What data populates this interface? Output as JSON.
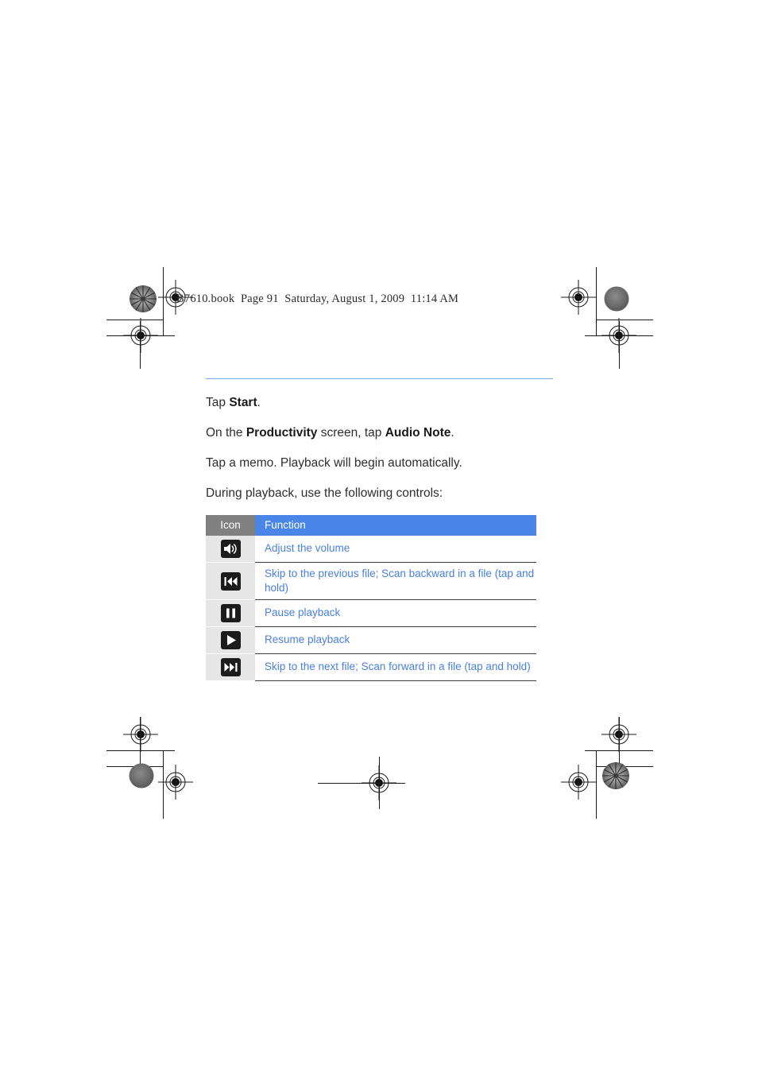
{
  "page": {
    "file_line": "B7610.book  Page 91  Saturday, August 1, 2009  11:14 AM",
    "rule_color": "#7ba7f0",
    "background": "#ffffff"
  },
  "body": {
    "paragraphs": [
      {
        "parts": [
          {
            "text": "Tap ",
            "bold": false
          },
          {
            "text": "Start",
            "bold": true
          },
          {
            "text": ".",
            "bold": false
          }
        ]
      },
      {
        "parts": [
          {
            "text": "On the ",
            "bold": false
          },
          {
            "text": "Productivity",
            "bold": true
          },
          {
            "text": " screen, tap ",
            "bold": false
          },
          {
            "text": "Audio Note",
            "bold": true
          },
          {
            "text": ".",
            "bold": false
          }
        ]
      },
      {
        "parts": [
          {
            "text": "Tap a memo. Playback will begin automatically.",
            "bold": false
          }
        ]
      },
      {
        "parts": [
          {
            "text": "During playback, use the following controls:",
            "bold": false
          }
        ]
      }
    ]
  },
  "table": {
    "header_icon_label": "Icon",
    "header_function_label": "Function",
    "header_icon_bg": "#808080",
    "header_function_bg": "#4a86e8",
    "row_text_color": "#4a7fe0",
    "icon_cell_bg": "#e6e6e6",
    "rows": [
      {
        "icon": "volume-icon",
        "function": "Adjust the volume"
      },
      {
        "icon": "skip-previous-icon",
        "function": "Skip to the previous file; Scan backward in a file (tap and hold)"
      },
      {
        "icon": "pause-icon",
        "function": "Pause playback"
      },
      {
        "icon": "play-icon",
        "function": "Resume playback"
      },
      {
        "icon": "skip-next-icon",
        "function": "Skip to the next file; Scan forward in a file (tap and hold)"
      }
    ]
  }
}
